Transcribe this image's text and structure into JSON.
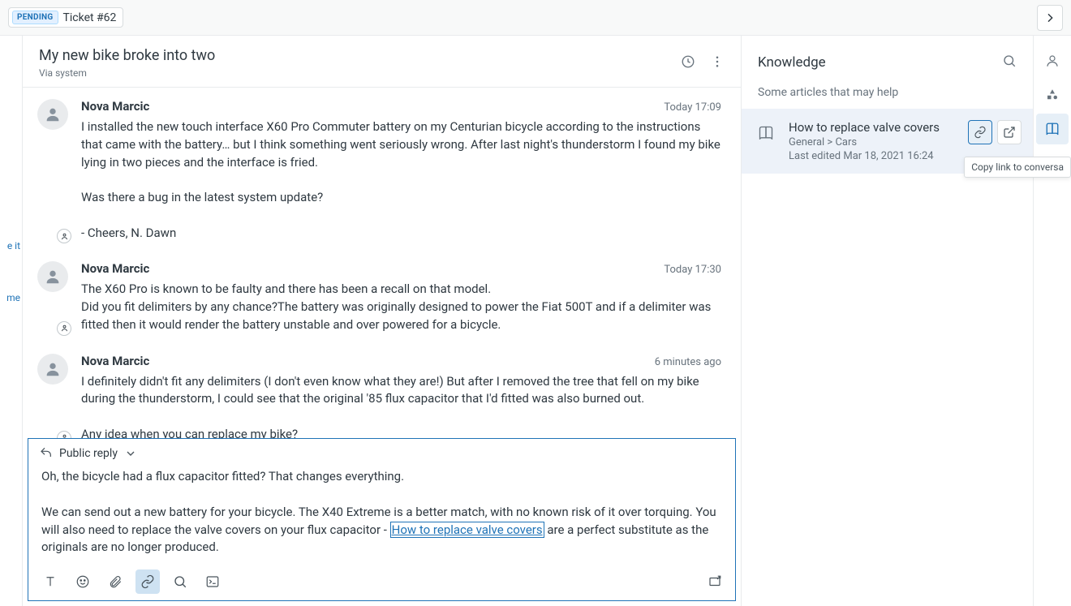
{
  "topbar": {
    "status": "PENDING",
    "ticket_label": "Ticket #62"
  },
  "left_collapsed": {
    "frag1": "e it",
    "frag2": "me"
  },
  "header": {
    "title": "My new bike broke into two",
    "via": "Via system"
  },
  "messages": [
    {
      "author": "Nova Marcic",
      "time": "Today 17:09",
      "text": "I installed the new touch interface X60 Pro Commuter battery on my Centurian bicycle according to the instructions that came with the battery… but I think something went seriously wrong. After last night's thunderstorm I found my bike lying in two pieces and the interface is fried.\n\nWas there a bug in the latest system update?\n\n- Cheers, N. Dawn"
    },
    {
      "author": "Nova Marcic",
      "time": "Today 17:30",
      "text": "The X60 Pro is known to be faulty and there has been a recall on that model.\nDid you fit delimiters by any chance?The battery was originally designed to power the Fiat 500T and if a delimiter was fitted then it would render the battery unstable and over powered for a bicycle."
    },
    {
      "author": "Nova Marcic",
      "time": "6 minutes ago",
      "text": "I definitely didn't fit any delimiters (I don't even know what they are!) But after I removed the tree that fell on my bike during the thunderstorm, I could see that the original '85 flux capacitor that I'd fitted was also burned out.\n\nAny idea when you can replace my bike?"
    }
  ],
  "composer": {
    "channel_label": "Public reply",
    "body_before": "Oh, the bicycle had a flux capacitor fitted? That changes everything.\n\nWe can send out a new battery for your bicycle. The X40 Extreme is a better match, with no known risk of it over torquing. You will also need to replace the valve covers on your flux capacitor - ",
    "link_text": "How to replace valve covers",
    "body_after": " are a perfect substitute as the originals are no longer produced."
  },
  "knowledge": {
    "title": "Knowledge",
    "subtitle": "Some articles that may help",
    "article": {
      "title": "How to replace valve covers",
      "breadcrumb": "General > Cars",
      "edited": "Last edited Mar 18, 2021 16:24"
    }
  },
  "tooltip": "Copy link to conversa"
}
